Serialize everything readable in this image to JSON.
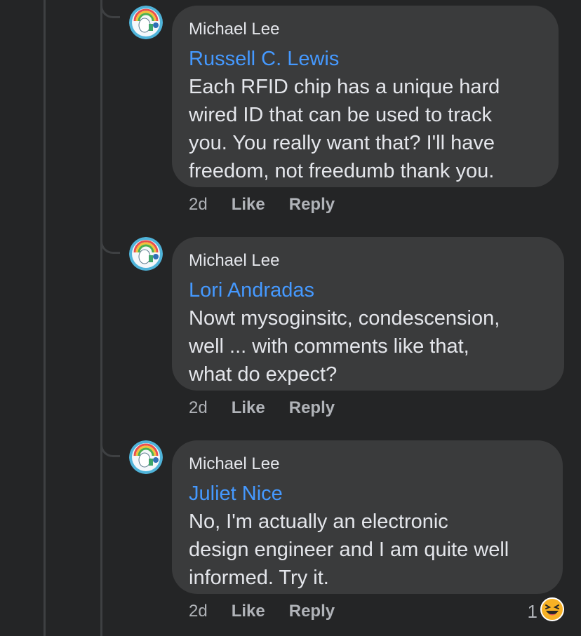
{
  "comments": [
    {
      "author": "Michael Lee",
      "mention": "Russell C. Lewis",
      "lines": [
        "Each RFID chip has a unique hard",
        "wired ID that can be used to  track",
        "you. You really want that? I'll have",
        "freedom,  not freedumb thank you."
      ],
      "time": "2d",
      "like_label": "Like",
      "reply_label": "Reply"
    },
    {
      "author": "Michael Lee",
      "mention": "Lori Andradas",
      "lines": [
        "Nowt mysoginsitc,  condescension,",
        "well ... with comments like that,",
        "what do expect?"
      ],
      "time": "2d",
      "like_label": "Like",
      "reply_label": "Reply"
    },
    {
      "author": "Michael Lee",
      "mention": "Juliet Nice",
      "lines": [
        "No, I'm actually an electronic",
        "design engineer and I am quite well",
        "informed.  Try it."
      ],
      "time": "2d",
      "like_label": "Like",
      "reply_label": "Reply",
      "reaction_count": "1",
      "reaction_icon": "laughing-emoji-icon"
    }
  ],
  "colors": {
    "background": "#242526",
    "bubble": "#3a3b3c",
    "mention": "#4599ff",
    "text": "#e4e6eb",
    "secondary": "#b0b3b8"
  }
}
